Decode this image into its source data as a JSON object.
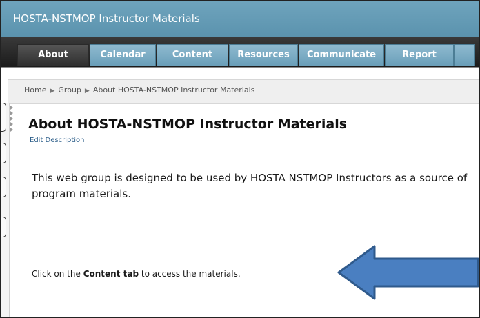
{
  "header": {
    "title": "HOSTA-NSTMOP Instructor Materials"
  },
  "tabs": [
    {
      "label": "About",
      "active": true
    },
    {
      "label": "Calendar",
      "active": false
    },
    {
      "label": "Content",
      "active": false
    },
    {
      "label": "Resources",
      "active": false
    },
    {
      "label": "Communicate",
      "active": false
    },
    {
      "label": "Report",
      "active": false
    }
  ],
  "breadcrumb": [
    "Home",
    "Group",
    "About HOSTA-NSTMOP Instructor Materials"
  ],
  "main": {
    "title": "About HOSTA-NSTMOP Instructor Materials",
    "edit_link": "Edit Description",
    "description": "This web group is designed to be used by HOSTA NSTMOP Instructors as a source of program materials.",
    "instruction_prefix": "Click on the ",
    "instruction_bold": "Content tab",
    "instruction_suffix": " to access the materials."
  },
  "icons": {
    "breadcrumb_separator": "triangle-right-icon",
    "callout_arrow": "left-arrow-icon"
  },
  "colors": {
    "header_blue": "#5b93ae",
    "tab_blue": "#7aabc4",
    "active_tab": "#3a3a3a",
    "arrow_fill": "#4a7fc1",
    "arrow_stroke": "#2f5a8c",
    "link": "#2e5f8a"
  }
}
